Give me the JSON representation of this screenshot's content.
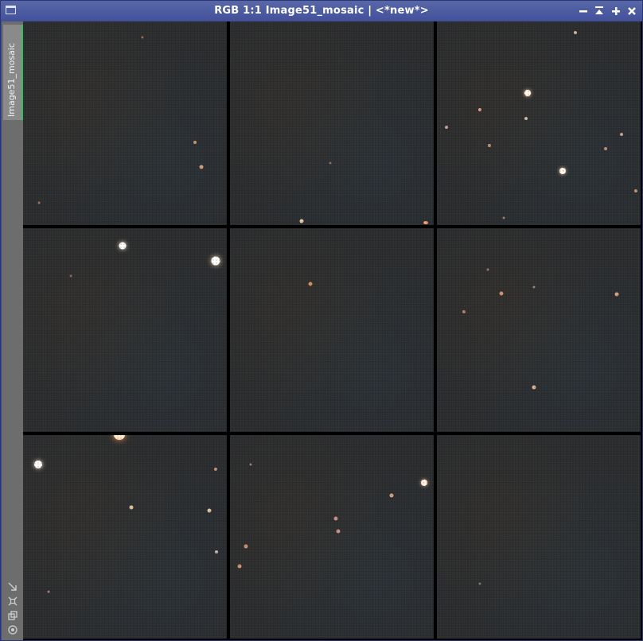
{
  "window": {
    "title": "RGB 1:1 Image51_mosaic | <*new*>",
    "controls": [
      "minimize-icon",
      "shade-icon",
      "maximize-icon",
      "close-icon"
    ]
  },
  "side_panel": {
    "tab_label": "Image51_mosaic",
    "tools": [
      "send-to-icon",
      "identify-icon",
      "clone-icon",
      "mask-icon"
    ]
  },
  "mosaic": {
    "grid": "3x3",
    "tiles": 9
  },
  "colors": {
    "titlebar": "#4a589e",
    "frame": "#3b4b8f",
    "sky": "#2a2c2e",
    "tab_accent": "#35c15b"
  }
}
